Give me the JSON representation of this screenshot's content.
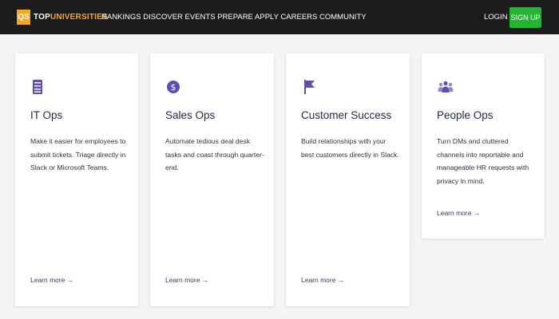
{
  "header": {
    "logo_badge": "QS",
    "logo_top": "TOP",
    "logo_universities": "UNIVERSITIES",
    "nav": [
      "RANKINGS",
      "DISCOVER",
      "EVENTS",
      "PREPARE",
      "APPLY",
      "CAREERS",
      "COMMUNITY"
    ],
    "login_label": "LOGIN",
    "signup_label": "SIGN UP"
  },
  "cards": [
    {
      "icon": "server-stack-icon",
      "title": "IT Ops",
      "description": "Make it easier for employees to submit tickets. Triage directly in Slack or Microsoft Teams.",
      "link": "Learn more →"
    },
    {
      "icon": "dollar-coin-icon",
      "title": "Sales Ops",
      "description": "Automate tedious deal desk tasks and coast through quarter-end.",
      "link": "Learn more →"
    },
    {
      "icon": "flag-icon",
      "title": "Customer Success",
      "description": "Build relationships with your best customers directly in Slack.",
      "link": "Learn more →"
    },
    {
      "icon": "people-group-icon",
      "title": "People Ops",
      "description": "Turn DMs and cluttered channels into reportable and manageable HR requests with privacy in mind.",
      "link": "Learn more →"
    }
  ],
  "colors": {
    "header_bg": "#1c1c1c",
    "brand_orange": "#f5a623",
    "signup_green": "#22b531",
    "icon_purple": "#5b4fb5",
    "page_bg": "#f3f4f6"
  }
}
